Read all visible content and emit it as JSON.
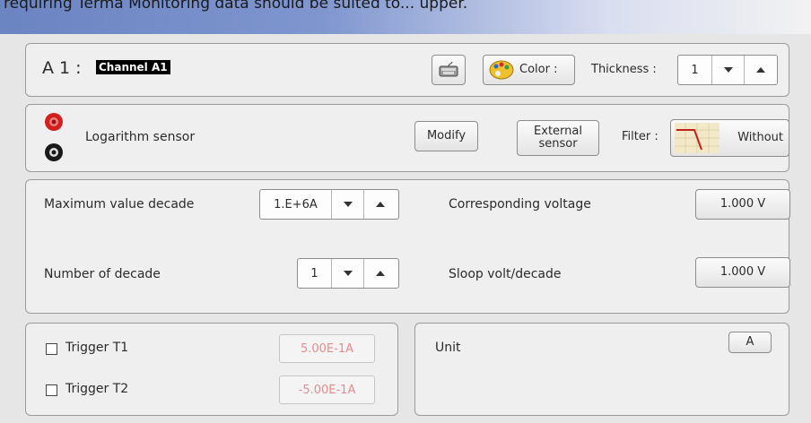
{
  "window": {
    "title": "   requiring Terma Monitoring data should be suited to... upper."
  },
  "channel": {
    "id": "A 1 :",
    "name": "Channel A1",
    "color_label": "Color :",
    "thickness_label": "Thickness :",
    "thickness_value": "1"
  },
  "sensor": {
    "type": "Logarithm sensor",
    "modify_label": "Modify",
    "external_label_1": "External",
    "external_label_2": "sensor",
    "filter_label": "Filter :",
    "filter_value": "Without"
  },
  "config": {
    "max_decade_label": "Maximum value decade",
    "max_decade_value": "1.E+6A",
    "num_decade_label": "Number of decade",
    "num_decade_value": "1",
    "corr_voltage_label": "Corresponding voltage",
    "corr_voltage_value": "1.000 V",
    "sloop_label": "Sloop volt/decade",
    "sloop_value": "1.000 V"
  },
  "triggers": [
    {
      "label": "Trigger T1",
      "value": "5.00E-1A"
    },
    {
      "label": "Trigger T2",
      "value": "-5.00E-1A"
    }
  ],
  "unit": {
    "label": "Unit",
    "value": "A"
  },
  "colors": {
    "disabled_text": "#e48c8c",
    "terminal_red": "#d02020",
    "terminal_black": "#1a1a1a"
  }
}
